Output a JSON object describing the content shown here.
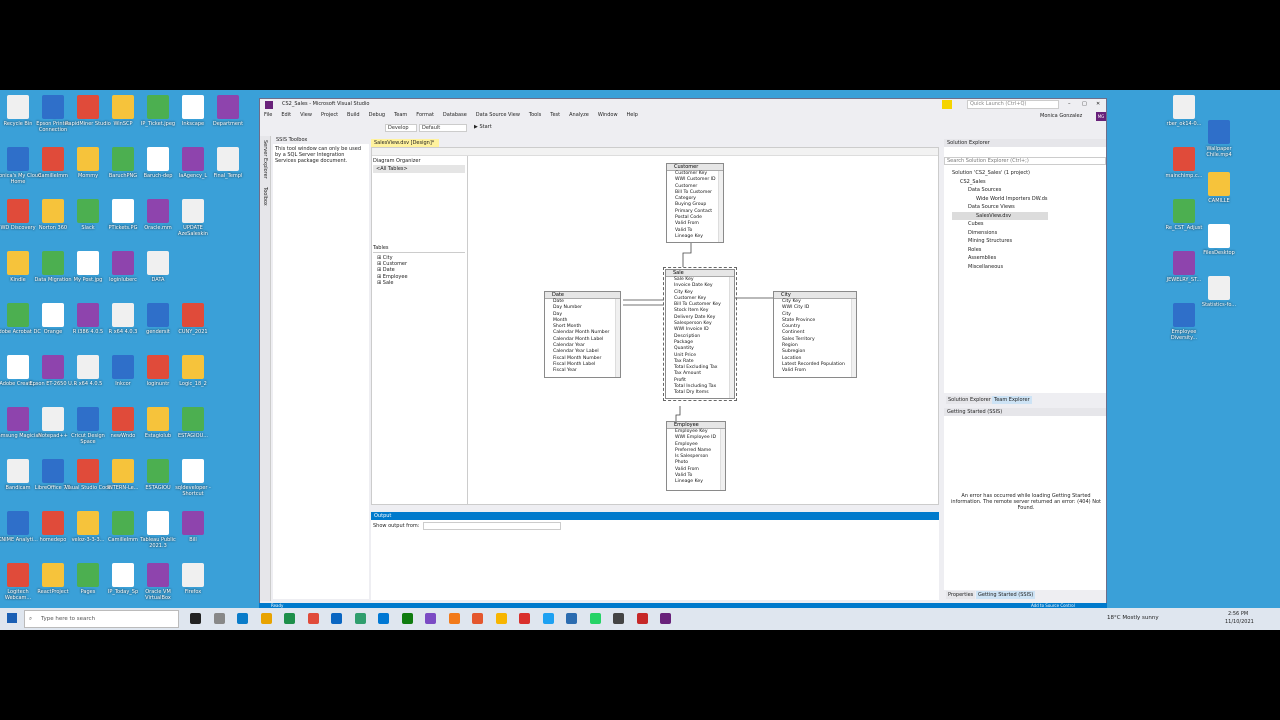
{
  "desktop": {
    "left_icons": [
      [
        "Recycle Bin",
        "Epson Printer Connection",
        "RapidMiner Studio",
        "WinSCP",
        "IP_Ticket.jpeg",
        "Inkscape",
        "Department"
      ],
      [
        "Monica's My Cloud Home",
        "CamilleImm",
        "Mommy",
        "BaruchPNG",
        "Baruch-dep",
        "IaAgency_L",
        "Final_Templ"
      ],
      [
        "WD Discovery",
        "Norton 360",
        "Slack",
        "PTickets.PG",
        "Oracle.mm",
        "UPDATE AzeSaleskin"
      ],
      [
        "Kindle",
        "Data Migration",
        "My Post.jpg",
        "loginluberc",
        "DATA"
      ],
      [
        "Adobe Acrobat DC",
        "Orange",
        "R i386 4.0.5",
        "R x64 4.0.3",
        "gendersit",
        "CUNY_2021"
      ],
      [
        "Adobe Creati...",
        "Epson ET-2650 U...",
        "R x64 4.0.5",
        "Inkcor",
        "loginuntr",
        "Logic_18_2"
      ],
      [
        "Samsung Magician",
        "Notepad++",
        "Cricut Design Space",
        "newWndo",
        "Estagiolub",
        "ESTAGIOU..."
      ],
      [
        "Bandicam",
        "LibreOffice 7.1",
        "Visual Studio Code",
        "INTERN-Le...",
        "ESTAGIOU",
        "sqldeveloper - Shortcut"
      ],
      [
        "KNIME Analyti...",
        "homedepo",
        "veloz-3-3-3...",
        "CamilleImm",
        "Tableau Public 2021.3",
        "Bill"
      ],
      [
        "Logitech Webcam...",
        "ReactProject",
        "Pages",
        "IP_Today_Sp",
        "Oracle VM VirtualBox",
        "Firefox"
      ]
    ],
    "right_icons": [
      "rber_ok14-0...",
      "Wallpaper Chile.mp4",
      "mainchimp.c...",
      "CAMILLE",
      "Re_CST_Adjust",
      "FilesDesktop",
      "JEWELRY_ST...",
      "Statistics-fo...",
      "Employee Diversity..."
    ]
  },
  "vs": {
    "title": "CS2_Sales - Microsoft Visual Studio",
    "quick_launch_placeholder": "Quick Launch (Ctrl+Q)",
    "user": "Monica Gonzalez",
    "user_initials": "MG",
    "menu": [
      "File",
      "Edit",
      "View",
      "Project",
      "Build",
      "Debug",
      "Team",
      "Format",
      "Database",
      "Data Source View",
      "Tools",
      "Test",
      "Analyze",
      "Window",
      "Help"
    ],
    "config": "Develop",
    "platform": "Default",
    "start_label": "Start",
    "side_tabs": [
      "Server Explorer",
      "Toolbox"
    ],
    "toolbox": {
      "title": "SSIS Toolbox",
      "message": "This tool window can only be used by a SQL Server Integration Services package document."
    },
    "doc_tab": "SalesView.dsv [Design]*",
    "diagram_organizer": {
      "title": "Diagram Organizer",
      "item": "<All Tables>"
    },
    "tables": {
      "title": "Tables",
      "items": [
        "City",
        "Customer",
        "Date",
        "Employee",
        "Sale"
      ]
    },
    "entities": {
      "customer": {
        "name": "Customer",
        "fields": [
          "Customer Key",
          "WWI Customer ID",
          "Customer",
          "Bill To Customer",
          "Category",
          "Buying Group",
          "Primary Contact",
          "Postal Code",
          "Valid From",
          "Valid To",
          "Lineage Key"
        ]
      },
      "sale": {
        "name": "Sale",
        "fields": [
          "Sale Key",
          "Invoice Date Key",
          "City Key",
          "Customer Key",
          "Bill To Customer Key",
          "Stock Item Key",
          "Delivery Date Key",
          "Salesperson Key",
          "WWI Invoice ID",
          "Description",
          "Package",
          "Quantity",
          "Unit Price",
          "Tax Rate",
          "Total Excluding Tax",
          "Tax Amount",
          "Profit",
          "Total Including Tax",
          "Total Dry Items"
        ]
      },
      "date": {
        "name": "Date",
        "fields": [
          "Date",
          "Day Number",
          "Day",
          "Month",
          "Short Month",
          "Calendar Month Number",
          "Calendar Month Label",
          "Calendar Year",
          "Calendar Year Label",
          "Fiscal Month Number",
          "Fiscal Month Label",
          "Fiscal Year",
          "Fiscal Year Label"
        ]
      },
      "city": {
        "name": "City",
        "fields": [
          "City Key",
          "WWI City ID",
          "City",
          "State Province",
          "Country",
          "Continent",
          "Sales Territory",
          "Region",
          "Subregion",
          "Location",
          "Latest Recorded Population",
          "Valid From",
          "Valid To"
        ]
      },
      "employee": {
        "name": "Employee",
        "fields": [
          "Employee Key",
          "WWI Employee ID",
          "Employee",
          "Preferred Name",
          "Is Salesperson",
          "Photo",
          "Valid From",
          "Valid To",
          "Lineage Key"
        ]
      }
    },
    "output": {
      "title": "Output",
      "show_from_label": "Show output from:"
    },
    "solution_explorer": {
      "title": "Solution Explorer",
      "search_placeholder": "Search Solution Explorer (Ctrl+;)",
      "tree": [
        {
          "level": 0,
          "label": "Solution 'CS2_Sales' (1 project)"
        },
        {
          "level": 1,
          "label": "CS2_Sales"
        },
        {
          "level": 2,
          "label": "Data Sources"
        },
        {
          "level": 3,
          "label": "Wide World Importers DW.ds"
        },
        {
          "level": 2,
          "label": "Data Source Views"
        },
        {
          "level": 3,
          "label": "SalesView.dsv"
        },
        {
          "level": 2,
          "label": "Cubes"
        },
        {
          "level": 2,
          "label": "Dimensions"
        },
        {
          "level": 2,
          "label": "Mining Structures"
        },
        {
          "level": 2,
          "label": "Roles"
        },
        {
          "level": 2,
          "label": "Assemblies"
        },
        {
          "level": 2,
          "label": "Miscellaneous"
        }
      ],
      "tab1": "Solution Explorer",
      "tab2": "Team Explorer"
    },
    "getting_started": {
      "title": "Getting Started (SSIS)",
      "message": "An error has occurred while loading Getting Started information. The remote server returned an error: (404) Not Found.",
      "tab1": "Properties",
      "tab2": "Getting Started (SSIS)"
    },
    "status": {
      "left": "Ready",
      "right": "Add to Source Control"
    }
  },
  "taskbar": {
    "search_placeholder": "Type here to search",
    "weather": "18°C  Mostly sunny",
    "time": "2:56 PM",
    "date": "11/10/2021"
  }
}
